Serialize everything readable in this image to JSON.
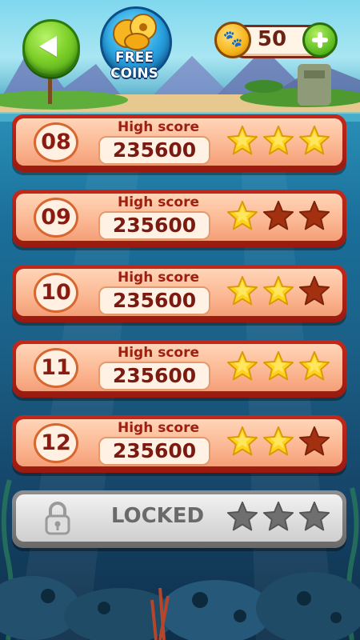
{
  "top_bar": {
    "free_coins_line1": "FREE",
    "free_coins_line2": "COINS",
    "coin_icon": "paw-coin-icon",
    "coin_count": "50",
    "back_icon": "back-arrow-icon",
    "add_icon": "plus-icon"
  },
  "levels": [
    {
      "number": "08",
      "high_score_label": "High score",
      "score": "235600",
      "stars": 3
    },
    {
      "number": "09",
      "high_score_label": "High score",
      "score": "235600",
      "stars": 1
    },
    {
      "number": "10",
      "high_score_label": "High score",
      "score": "235600",
      "stars": 2
    },
    {
      "number": "11",
      "high_score_label": "High score",
      "score": "235600",
      "stars": 3
    },
    {
      "number": "12",
      "high_score_label": "High score",
      "score": "235600",
      "stars": 2
    }
  ],
  "locked_level": {
    "label": "LOCKED",
    "lock_icon": "padlock-icon",
    "stars": 0
  },
  "colors": {
    "star_earned": "#ffd21f",
    "star_empty": "#a3310f",
    "star_locked": "#6f6f6f",
    "row_border": "#c4281a",
    "accent_green": "#55b81c"
  }
}
